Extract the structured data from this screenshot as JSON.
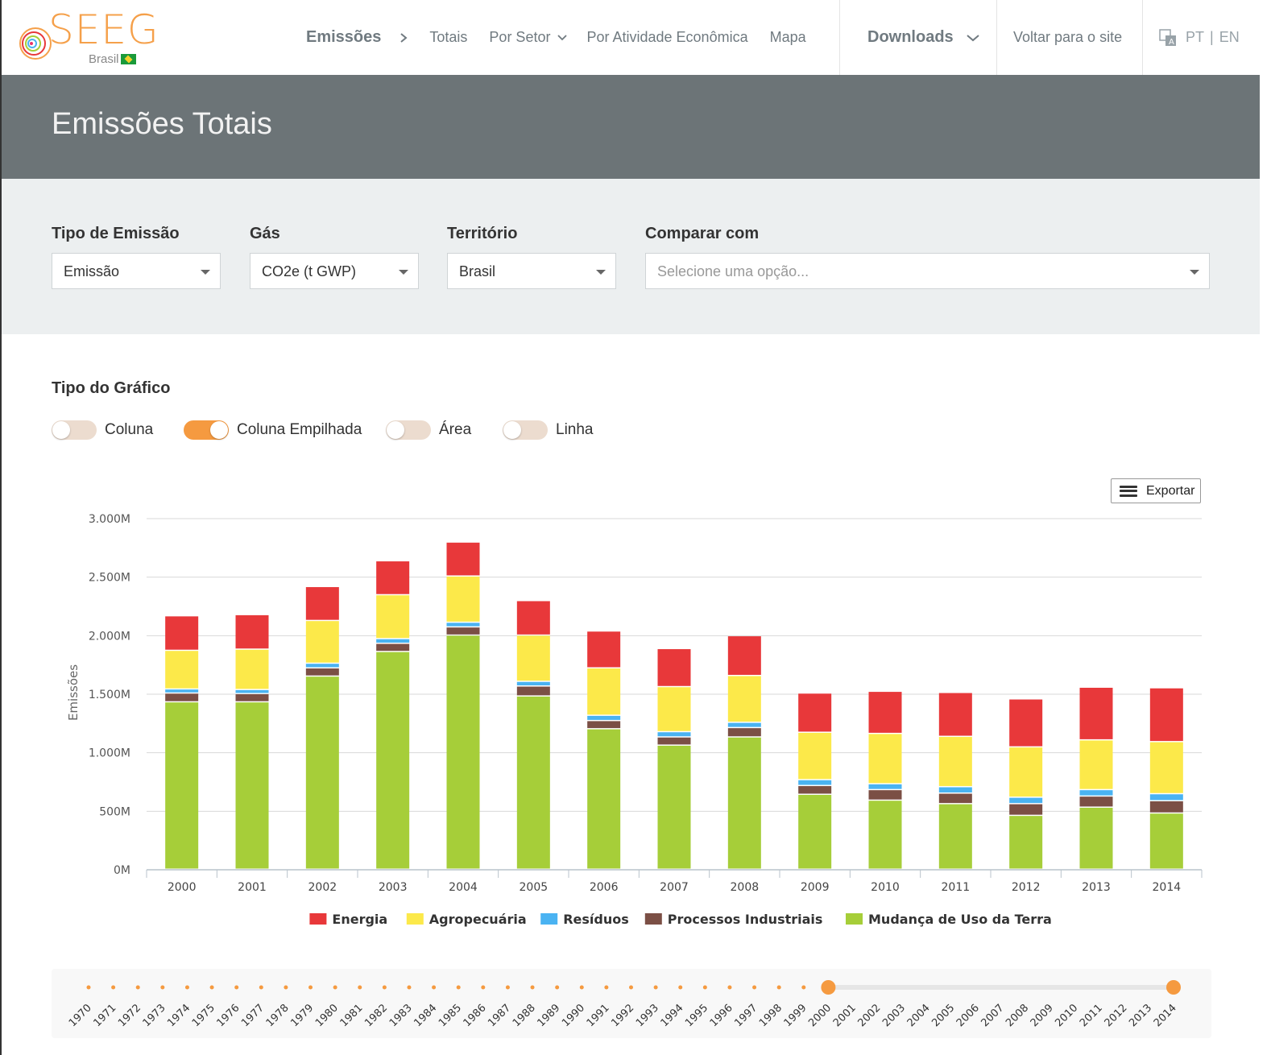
{
  "logo": {
    "word": "SEEG",
    "sub": "Brasil"
  },
  "nav": {
    "emissoes": "Emissões",
    "totais": "Totais",
    "por_setor": "Por Setor",
    "por_atividade": "Por Atividade Econômica",
    "mapa": "Mapa",
    "downloads": "Downloads",
    "voltar": "Voltar para o site",
    "lang_pt": "PT",
    "lang_sep": "|",
    "lang_en": "EN"
  },
  "page_title": "Emissões Totais",
  "filters": {
    "tipo_label": "Tipo de Emissão",
    "tipo_value": "Emissão",
    "gas_label": "Gás",
    "gas_value": "CO2e (t GWP)",
    "territorio_label": "Território",
    "territorio_value": "Brasil",
    "comparar_label": "Comparar com",
    "comparar_placeholder": "Selecione uma opção..."
  },
  "chart_type": {
    "title": "Tipo do Gráfico",
    "options": [
      {
        "label": "Coluna",
        "on": false
      },
      {
        "label": "Coluna Empilhada",
        "on": true
      },
      {
        "label": "Área",
        "on": false
      },
      {
        "label": "Linha",
        "on": false
      }
    ]
  },
  "export_label": "Exportar",
  "chart_data": {
    "type": "bar",
    "stacked": true,
    "categories": [
      "2000",
      "2001",
      "2002",
      "2003",
      "2004",
      "2005",
      "2006",
      "2007",
      "2008",
      "2009",
      "2010",
      "2011",
      "2012",
      "2013",
      "2014"
    ],
    "ylabel": "Emissões",
    "ylim": [
      0,
      3000
    ],
    "yticks": [
      "0M",
      "500M",
      "1.000M",
      "1.500M",
      "2.000M",
      "2.500M",
      "3.000M"
    ],
    "ytick_values": [
      0,
      500,
      1000,
      1500,
      2000,
      2500,
      3000
    ],
    "unit": "M",
    "legend_position": "bottom",
    "series": [
      {
        "name": "Mudança de Uso da Terra",
        "color": "#a6ce39",
        "values": [
          1430,
          1430,
          1650,
          1860,
          2000,
          1480,
          1200,
          1060,
          1130,
          640,
          590,
          560,
          460,
          530,
          480
        ]
      },
      {
        "name": "Processos Industriais",
        "color": "#7b4f45",
        "values": [
          75,
          70,
          70,
          70,
          70,
          85,
          70,
          70,
          80,
          75,
          90,
          90,
          100,
          95,
          105
        ]
      },
      {
        "name": "Resíduos",
        "color": "#4ab3f2",
        "values": [
          35,
          35,
          40,
          40,
          40,
          40,
          45,
          45,
          45,
          50,
          50,
          55,
          55,
          55,
          60
        ]
      },
      {
        "name": "Agropecuária",
        "color": "#fce94a",
        "values": [
          330,
          345,
          365,
          375,
          395,
          395,
          405,
          385,
          400,
          405,
          430,
          430,
          430,
          425,
          445
        ]
      },
      {
        "name": "Energia",
        "color": "#e8383a",
        "values": [
          295,
          295,
          290,
          290,
          290,
          295,
          315,
          325,
          340,
          335,
          360,
          375,
          410,
          450,
          460
        ]
      }
    ],
    "legend_order": [
      "Energia",
      "Agropecuária",
      "Resíduos",
      "Processos Industriais",
      "Mudança de Uso da Terra"
    ]
  },
  "timeline": {
    "years": [
      "1970",
      "1971",
      "1972",
      "1973",
      "1974",
      "1975",
      "1976",
      "1977",
      "1978",
      "1979",
      "1980",
      "1981",
      "1982",
      "1983",
      "1984",
      "1985",
      "1986",
      "1987",
      "1988",
      "1989",
      "1990",
      "1991",
      "1992",
      "1993",
      "1994",
      "1995",
      "1996",
      "1997",
      "1998",
      "1999",
      "2000",
      "2001",
      "2002",
      "2003",
      "2004",
      "2005",
      "2006",
      "2007",
      "2008",
      "2009",
      "2010",
      "2011",
      "2012",
      "2013",
      "2014"
    ],
    "start": "2000",
    "end": "2014",
    "accent": "#f59a40"
  }
}
